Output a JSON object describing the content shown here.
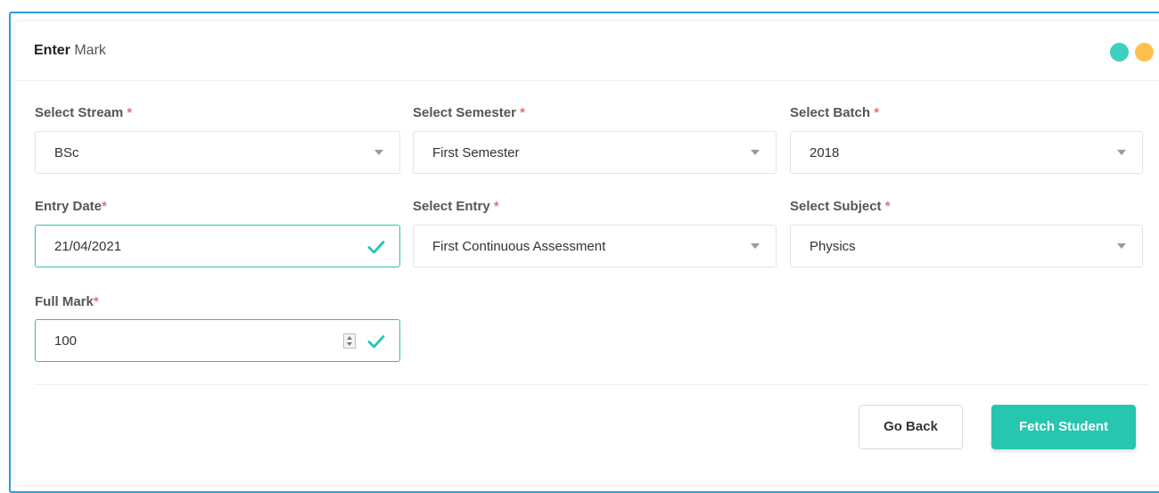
{
  "header": {
    "title_bold": "Enter",
    "title_rest": " Mark",
    "dot_colors": [
      "#3ed0be",
      "#ffc14d"
    ]
  },
  "form": {
    "required_mark": "*",
    "stream": {
      "label": "Select Stream ",
      "value": "BSc"
    },
    "semester": {
      "label": "Select Semester ",
      "value": "First Semester"
    },
    "batch": {
      "label": "Select Batch ",
      "value": "2018"
    },
    "entry_date": {
      "label": "Entry Date",
      "value": "21/04/2021"
    },
    "entry": {
      "label": "Select Entry ",
      "value": "First Continuous Assessment"
    },
    "subject": {
      "label": "Select Subject ",
      "value": "Physics"
    },
    "full_mark": {
      "label": "Full Mark",
      "value": "100"
    }
  },
  "actions": {
    "back_label": "Go Back",
    "fetch_label": "Fetch Student"
  },
  "colors": {
    "accent": "#26c6b1",
    "frame": "#26a0d8",
    "required": "#e57373"
  }
}
